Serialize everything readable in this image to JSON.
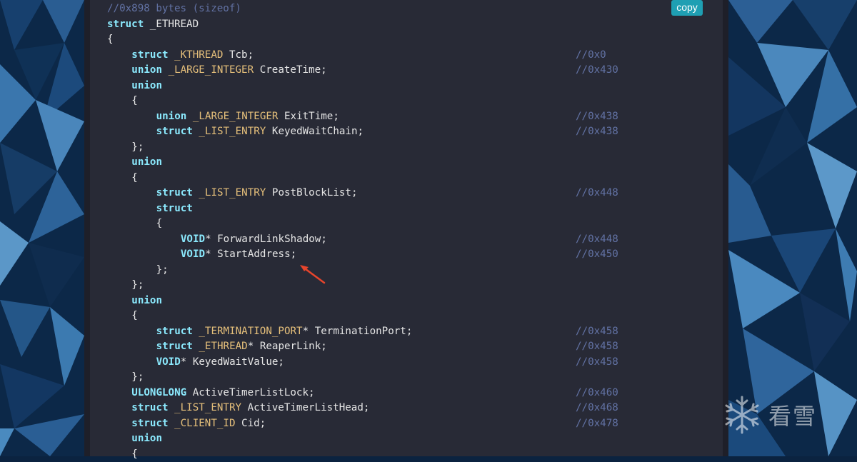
{
  "toolbar": {
    "copy_label": "copy"
  },
  "watermark": {
    "text": "看雪"
  },
  "colors": {
    "keyword": "#8be9fd",
    "type": "#e6c07b",
    "comment": "#6272a4",
    "panel_bg": "#282a36",
    "copy_bg": "#1f9fb3",
    "arrow": "#e8452c"
  },
  "code": {
    "lines": [
      {
        "indent": 0,
        "tokens": [
          [
            "cm",
            "//0x898 bytes (sizeof)"
          ]
        ],
        "offset": ""
      },
      {
        "indent": 0,
        "tokens": [
          [
            "kw",
            "struct"
          ],
          [
            "id",
            " _ETHREAD"
          ]
        ],
        "offset": ""
      },
      {
        "indent": 0,
        "tokens": [
          [
            "id",
            "{"
          ]
        ],
        "offset": ""
      },
      {
        "indent": 1,
        "tokens": [
          [
            "kw",
            "struct"
          ],
          [
            "id",
            " "
          ],
          [
            "ty",
            "_KTHREAD"
          ],
          [
            "id",
            " Tcb;"
          ]
        ],
        "offset": "//0x0"
      },
      {
        "indent": 1,
        "tokens": [
          [
            "kw",
            "union"
          ],
          [
            "id",
            " "
          ],
          [
            "ty",
            "_LARGE_INTEGER"
          ],
          [
            "id",
            " CreateTime;"
          ]
        ],
        "offset": "//0x430"
      },
      {
        "indent": 1,
        "tokens": [
          [
            "kw",
            "union"
          ]
        ],
        "offset": ""
      },
      {
        "indent": 1,
        "tokens": [
          [
            "id",
            "{"
          ]
        ],
        "offset": ""
      },
      {
        "indent": 2,
        "tokens": [
          [
            "kw",
            "union"
          ],
          [
            "id",
            " "
          ],
          [
            "ty",
            "_LARGE_INTEGER"
          ],
          [
            "id",
            " ExitTime;"
          ]
        ],
        "offset": "//0x438"
      },
      {
        "indent": 2,
        "tokens": [
          [
            "kw",
            "struct"
          ],
          [
            "id",
            " "
          ],
          [
            "ty",
            "_LIST_ENTRY"
          ],
          [
            "id",
            " KeyedWaitChain;"
          ]
        ],
        "offset": "//0x438"
      },
      {
        "indent": 1,
        "tokens": [
          [
            "id",
            "};"
          ]
        ],
        "offset": ""
      },
      {
        "indent": 1,
        "tokens": [
          [
            "kw",
            "union"
          ]
        ],
        "offset": ""
      },
      {
        "indent": 1,
        "tokens": [
          [
            "id",
            "{"
          ]
        ],
        "offset": ""
      },
      {
        "indent": 2,
        "tokens": [
          [
            "kw",
            "struct"
          ],
          [
            "id",
            " "
          ],
          [
            "ty",
            "_LIST_ENTRY"
          ],
          [
            "id",
            " PostBlockList;"
          ]
        ],
        "offset": "//0x448"
      },
      {
        "indent": 2,
        "tokens": [
          [
            "kw",
            "struct"
          ]
        ],
        "offset": ""
      },
      {
        "indent": 2,
        "tokens": [
          [
            "id",
            "{"
          ]
        ],
        "offset": ""
      },
      {
        "indent": 3,
        "tokens": [
          [
            "kw",
            "VOID"
          ],
          [
            "id",
            "* ForwardLinkShadow;"
          ]
        ],
        "offset": "//0x448"
      },
      {
        "indent": 3,
        "tokens": [
          [
            "kw",
            "VOID"
          ],
          [
            "id",
            "* StartAddress;"
          ]
        ],
        "offset": "//0x450"
      },
      {
        "indent": 2,
        "tokens": [
          [
            "id",
            "};"
          ]
        ],
        "offset": ""
      },
      {
        "indent": 1,
        "tokens": [
          [
            "id",
            "};"
          ]
        ],
        "offset": ""
      },
      {
        "indent": 1,
        "tokens": [
          [
            "kw",
            "union"
          ]
        ],
        "offset": ""
      },
      {
        "indent": 1,
        "tokens": [
          [
            "id",
            "{"
          ]
        ],
        "offset": ""
      },
      {
        "indent": 2,
        "tokens": [
          [
            "kw",
            "struct"
          ],
          [
            "id",
            " "
          ],
          [
            "ty",
            "_TERMINATION_PORT"
          ],
          [
            "id",
            "* TerminationPort;"
          ]
        ],
        "offset": "//0x458"
      },
      {
        "indent": 2,
        "tokens": [
          [
            "kw",
            "struct"
          ],
          [
            "id",
            " "
          ],
          [
            "ty",
            "_ETHREAD"
          ],
          [
            "id",
            "* ReaperLink;"
          ]
        ],
        "offset": "//0x458"
      },
      {
        "indent": 2,
        "tokens": [
          [
            "kw",
            "VOID"
          ],
          [
            "id",
            "* KeyedWaitValue;"
          ]
        ],
        "offset": "//0x458"
      },
      {
        "indent": 1,
        "tokens": [
          [
            "id",
            "};"
          ]
        ],
        "offset": ""
      },
      {
        "indent": 1,
        "tokens": [
          [
            "kw",
            "ULONGLONG"
          ],
          [
            "id",
            " ActiveTimerListLock;"
          ]
        ],
        "offset": "//0x460"
      },
      {
        "indent": 1,
        "tokens": [
          [
            "kw",
            "struct"
          ],
          [
            "id",
            " "
          ],
          [
            "ty",
            "_LIST_ENTRY"
          ],
          [
            "id",
            " ActiveTimerListHead;"
          ]
        ],
        "offset": "//0x468"
      },
      {
        "indent": 1,
        "tokens": [
          [
            "kw",
            "struct"
          ],
          [
            "id",
            " "
          ],
          [
            "ty",
            "_CLIENT_ID"
          ],
          [
            "id",
            " Cid;"
          ]
        ],
        "offset": "//0x478"
      },
      {
        "indent": 1,
        "tokens": [
          [
            "kw",
            "union"
          ]
        ],
        "offset": ""
      },
      {
        "indent": 1,
        "tokens": [
          [
            "id",
            "{"
          ]
        ],
        "offset": ""
      }
    ]
  }
}
